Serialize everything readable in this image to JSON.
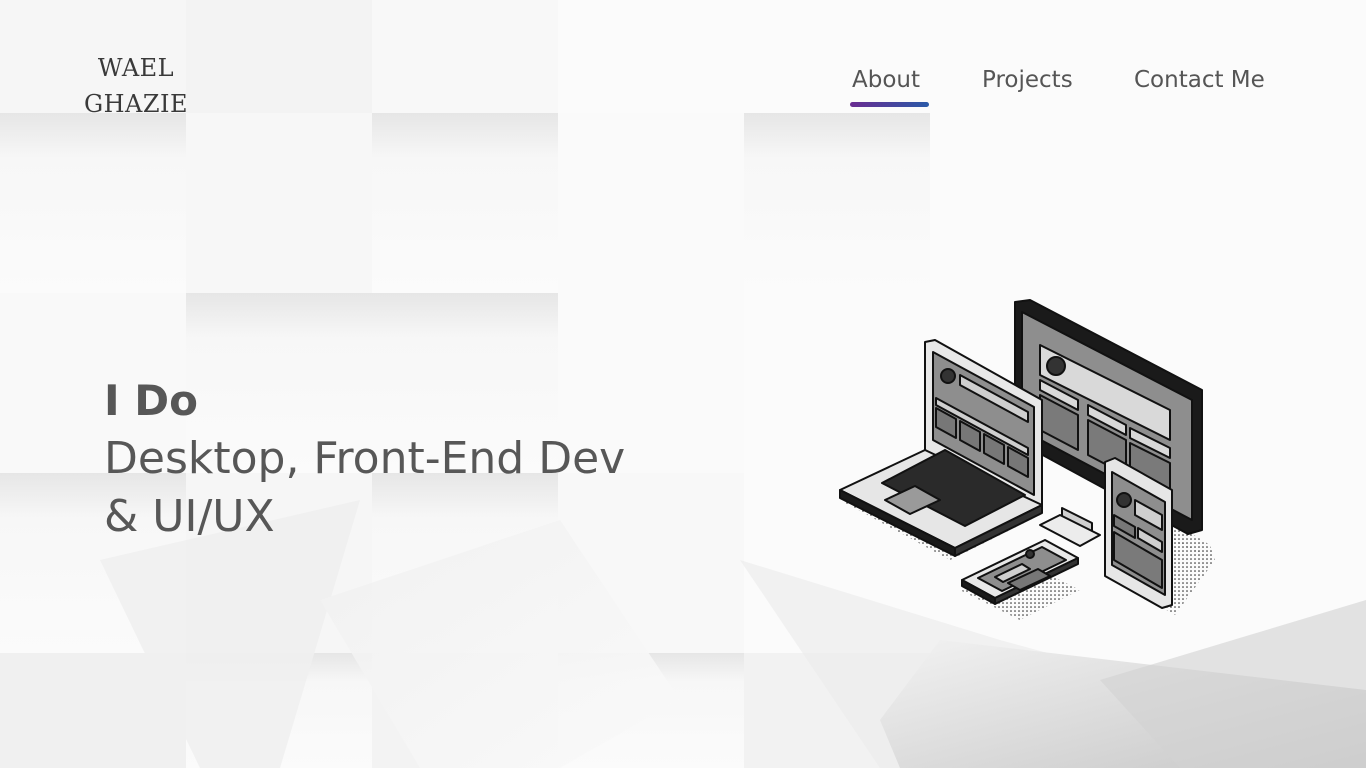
{
  "logo": {
    "line1": "WAEL",
    "line2": "GHAZIE"
  },
  "nav": {
    "items": [
      {
        "label": "About",
        "active": true
      },
      {
        "label": "Projects",
        "active": false
      },
      {
        "label": "Contact Me",
        "active": false
      }
    ],
    "underline_colors": [
      "#6a2c91",
      "#2a5aa8"
    ]
  },
  "hero": {
    "heading": "I Do",
    "line1": "Desktop, Front-End Dev",
    "line2": "& UI/UX"
  },
  "illustration": {
    "icon": "devices-illustration-icon"
  }
}
